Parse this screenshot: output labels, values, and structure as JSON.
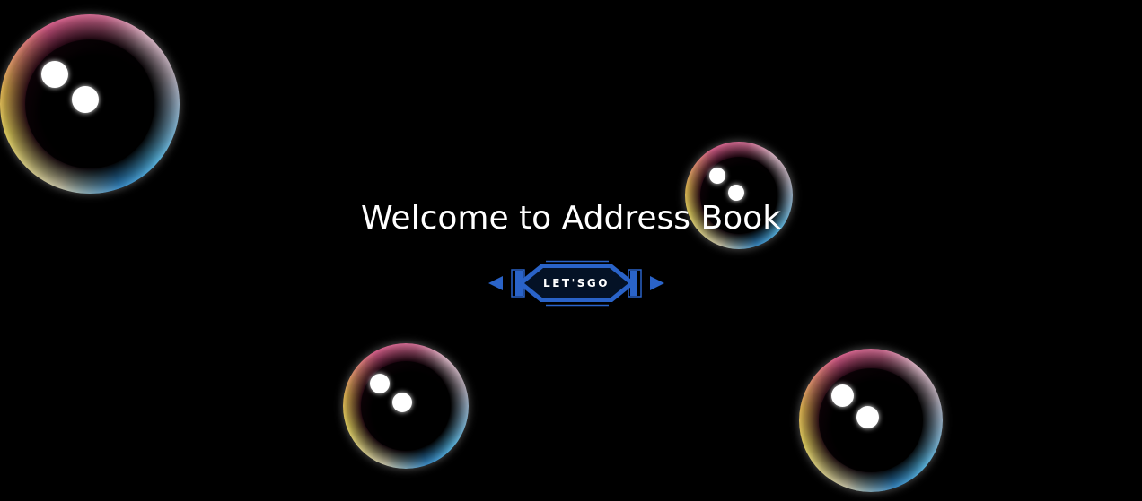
{
  "page": {
    "title": "Welcome to Address Book",
    "cta_label": "LET'SGO"
  },
  "colors": {
    "background": "#000000",
    "title_text": "#ffffff",
    "button_accent": "#2a63c8",
    "button_fill": "#041226",
    "bubble_rim": [
      "#e3cf58",
      "#e05a8a",
      "#2f88c9",
      "#c9c4a6"
    ]
  },
  "icons": {
    "left_arrow": "triangle-left-icon",
    "right_arrow": "triangle-right-icon"
  }
}
